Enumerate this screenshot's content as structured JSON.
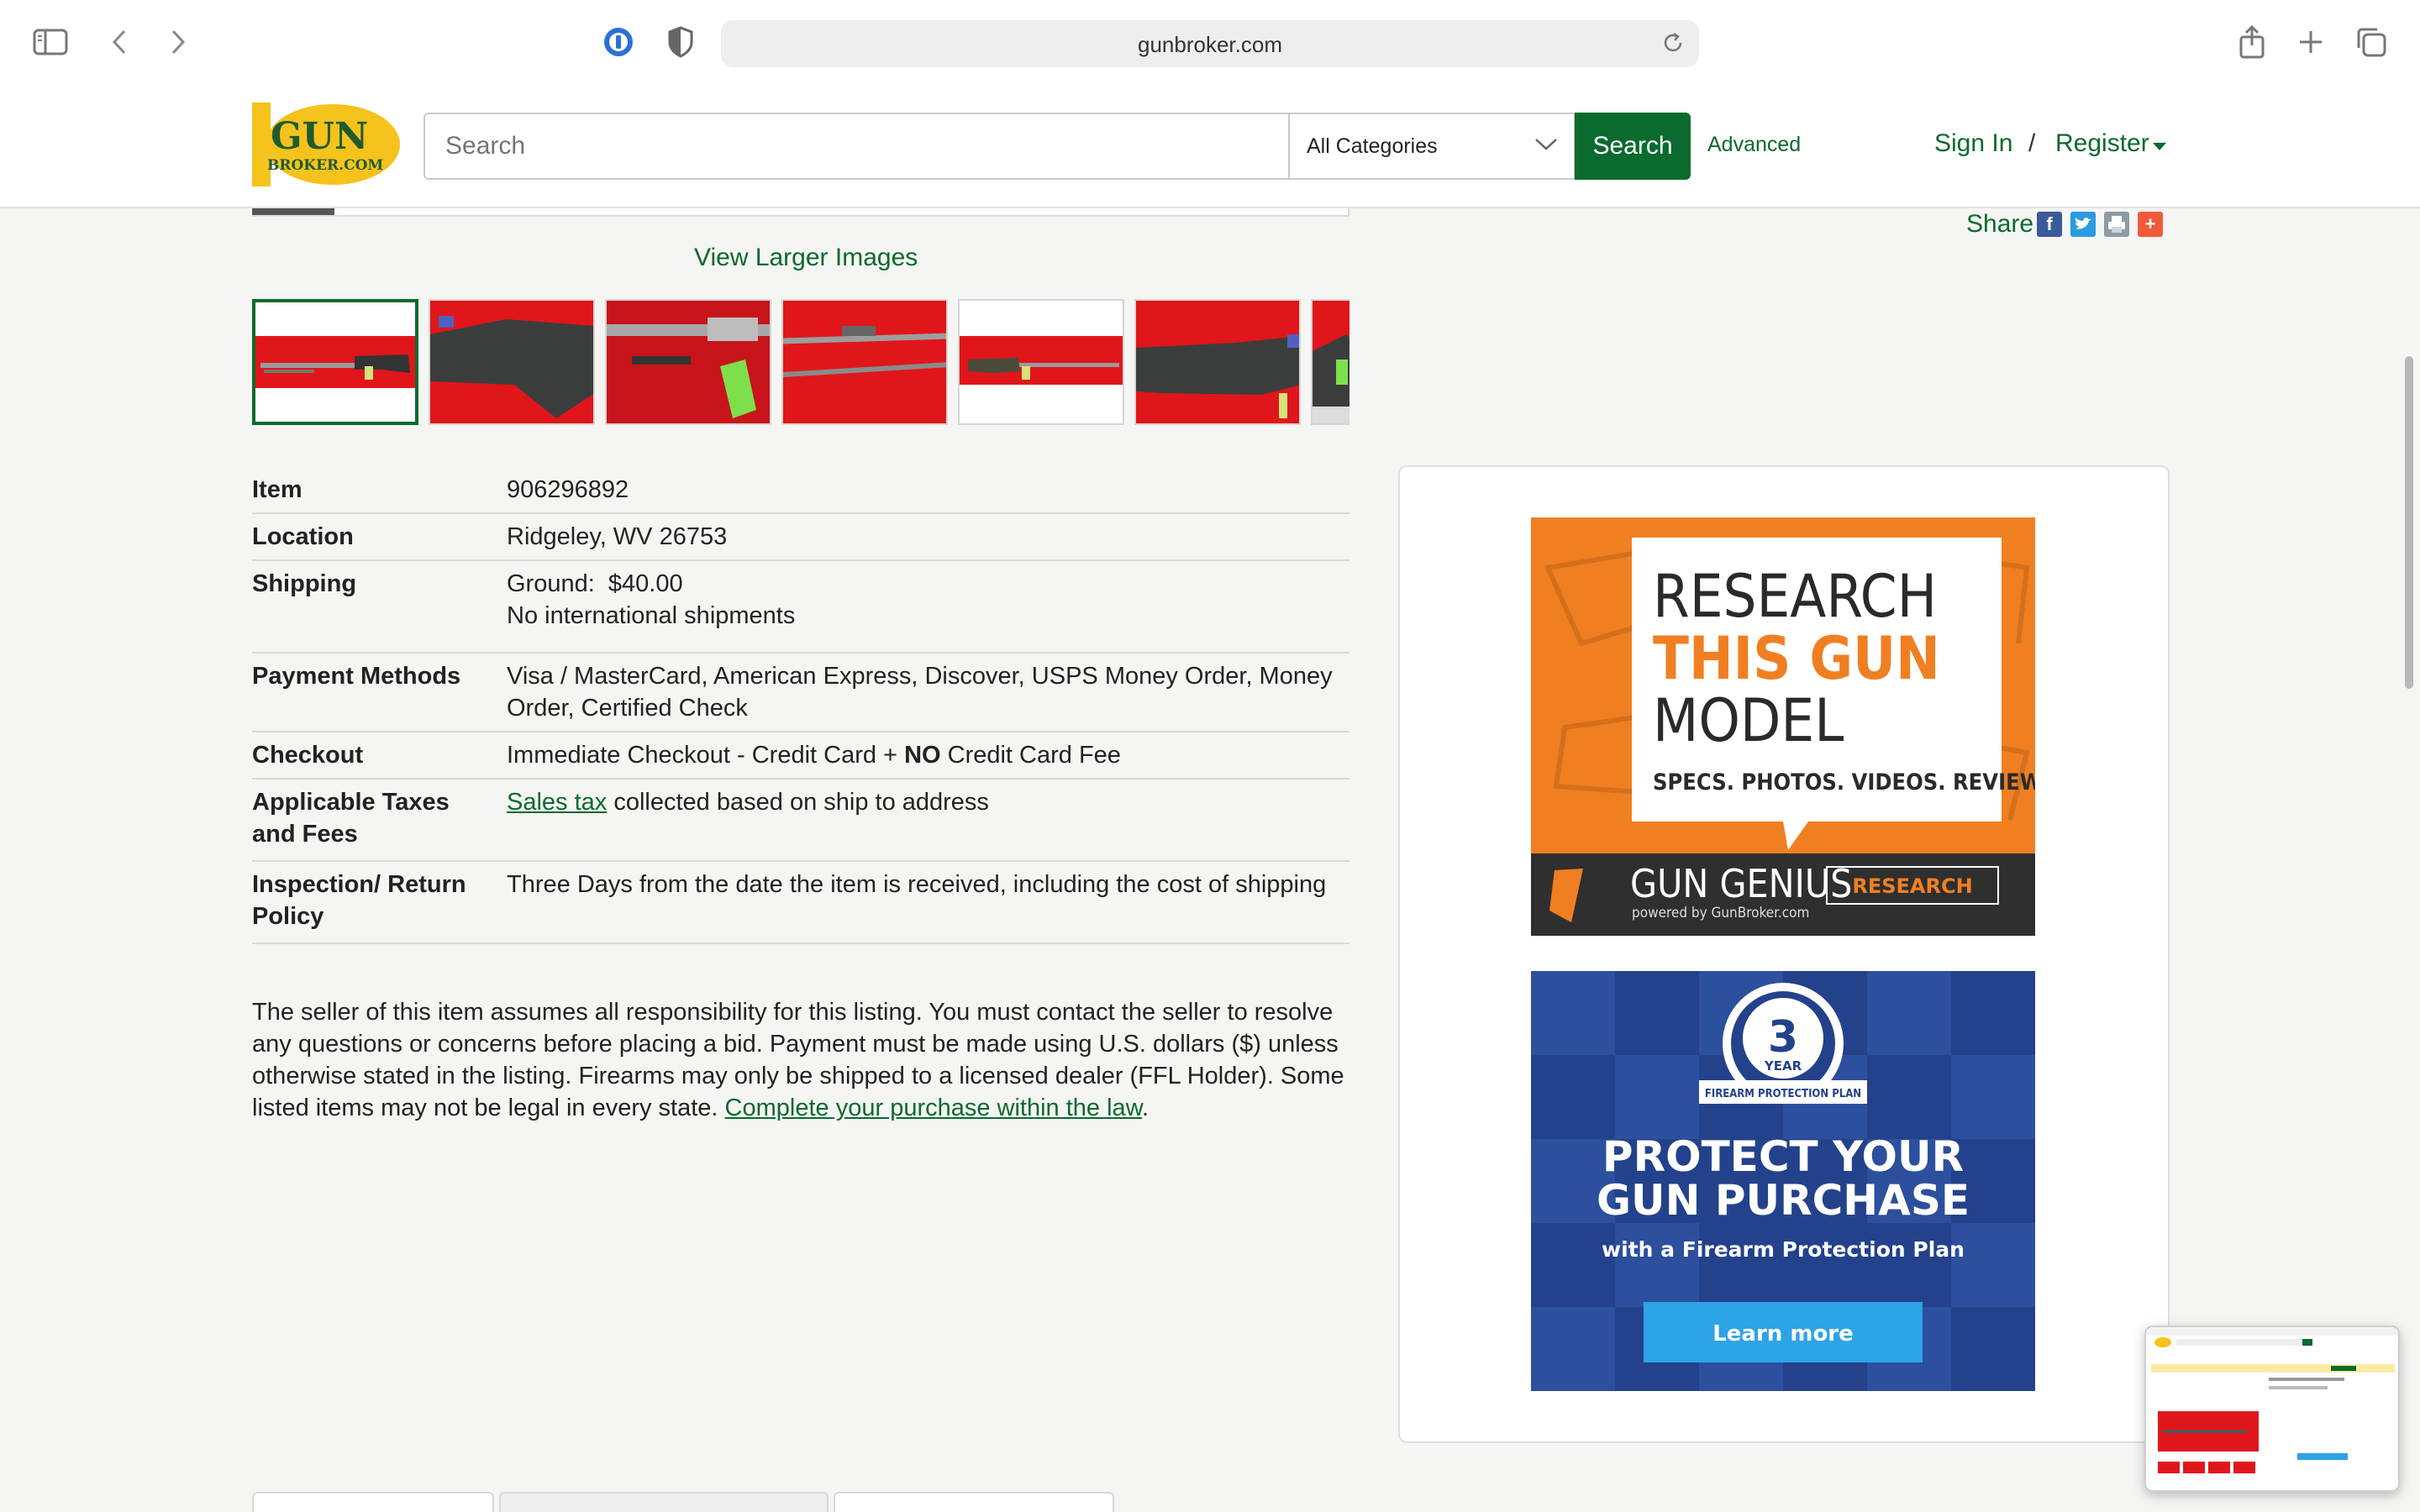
{
  "browser": {
    "url": "gunbroker.com",
    "icons": [
      "sidebar-toggle-icon",
      "back-icon",
      "forward-icon",
      "password-manager-icon",
      "privacy-shield-icon",
      "reload-icon",
      "share-icon",
      "new-tab-icon",
      "tab-overview-icon"
    ]
  },
  "header": {
    "logo_top": "GUN",
    "logo_bottom": "BROKER.COM",
    "search_placeholder": "Search",
    "category_selected": "All Categories",
    "search_button": "Search",
    "advanced_link": "Advanced",
    "sign_in": "Sign In",
    "separator": "/",
    "register": "Register"
  },
  "gallery": {
    "view_larger": "View Larger Images",
    "thumbnail_count": 7,
    "selected_index": 0
  },
  "details": {
    "item": {
      "label": "Item",
      "value": "906296892"
    },
    "location": {
      "label": "Location",
      "value": "Ridgeley, WV 26753"
    },
    "shipping": {
      "label": "Shipping",
      "line1": "Ground:  $40.00",
      "line2": "No international shipments"
    },
    "payment": {
      "label": "Payment Methods",
      "value": "Visa / MasterCard, American Express, Discover, USPS Money Order, Money Order, Certified Check"
    },
    "checkout": {
      "label": "Checkout",
      "prefix": "Immediate Checkout - Credit Card + ",
      "bold": "NO",
      "suffix": " Credit Card Fee"
    },
    "taxes": {
      "label": "Applicable Taxes and Fees",
      "link": "Sales tax",
      "text": " collected based on ship to address"
    },
    "inspection": {
      "label": "Inspection/ Return Policy",
      "value": "Three Days from the date the item is received, including the cost of shipping"
    }
  },
  "disclaimer": {
    "text": "The seller of this item assumes all responsibility for this listing. You must contact the seller to resolve any questions or concerns before placing a bid. Payment must be made using U.S. dollars ($) unless otherwise stated in the listing. Firearms may only be shipped to a licensed dealer (FFL Holder). Some listed items may not be legal in every state. ",
    "link": "Complete your purchase within the law",
    "end": "."
  },
  "share": {
    "label": "Share",
    "facebook": "f",
    "plus": "+"
  },
  "ads": {
    "research": {
      "line1": "RESEARCH",
      "line2": "THIS GUN",
      "line3": "MODEL",
      "tagline": "SPECS. PHOTOS. VIDEOS. REVIEWS.",
      "brand": "GUN GENIUS",
      "brand_sub": "powered by GunBroker.com",
      "button": "RESEARCH"
    },
    "protect": {
      "badge_number": "3",
      "badge_year": "YEAR",
      "badge_ribbon": "FIREARM PROTECTION PLAN",
      "line1": "PROTECT YOUR",
      "line2": "GUN PURCHASE",
      "line3": "with a Firearm Protection Plan",
      "button": "Learn more"
    }
  },
  "colors": {
    "brand_green": "#0b6a2d",
    "logo_yellow": "#f6c21c",
    "ad_orange": "#f07f22",
    "ad_blue": "#23428b",
    "button_blue": "#2ea3e6",
    "thumb_red": "#e0161b"
  }
}
